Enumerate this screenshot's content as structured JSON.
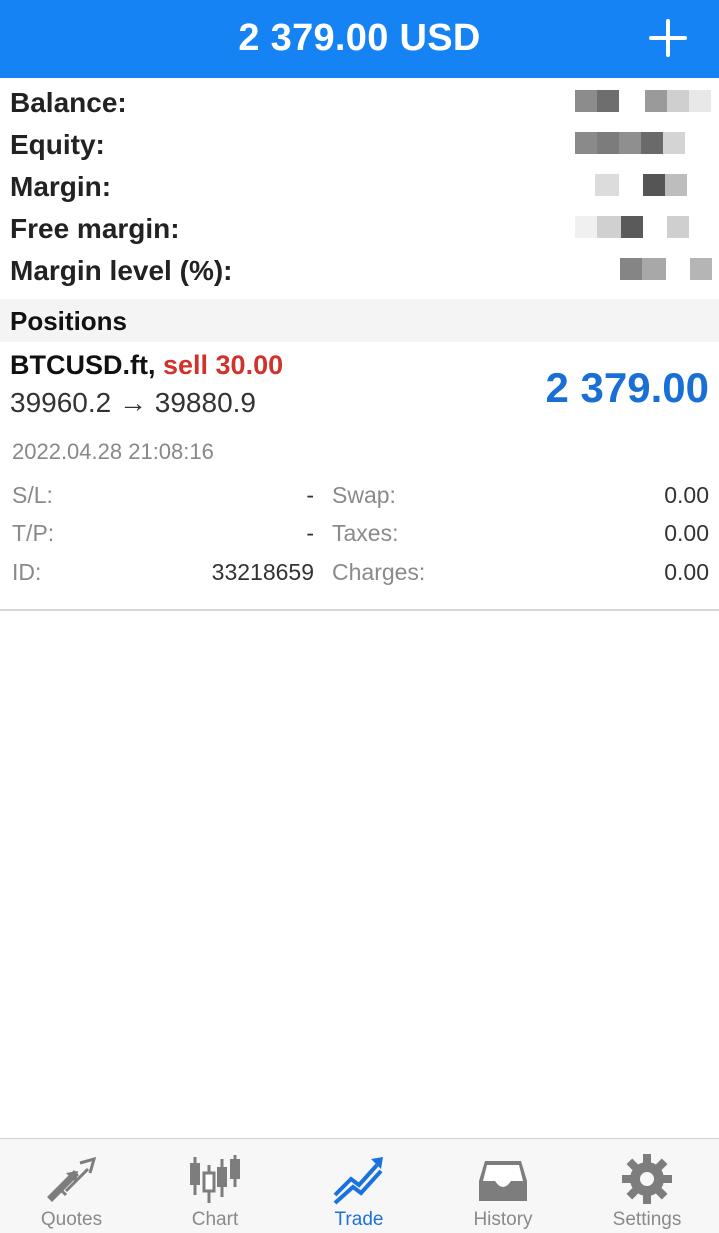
{
  "header": {
    "balance_title": "2 379.00 USD",
    "add_icon": "plus-icon"
  },
  "summary": {
    "items": [
      {
        "label": "Balance:"
      },
      {
        "label": "Equity:"
      },
      {
        "label": "Margin:"
      },
      {
        "label": "Free margin:"
      },
      {
        "label": "Margin level (%):"
      }
    ]
  },
  "positions": {
    "section_title": "Positions",
    "item": {
      "symbol": "BTCUSD.ft,",
      "side": "sell 30.00",
      "price_open": "39960.2",
      "arrow": "→",
      "price_current": "39880.9",
      "profit": "2 379.00",
      "time": "2022.04.28 21:08:16",
      "sl_label": "S/L:",
      "sl_value": "-",
      "tp_label": "T/P:",
      "tp_value": "-",
      "id_label": "ID:",
      "id_value": "33218659",
      "swap_label": "Swap:",
      "swap_value": "0.00",
      "taxes_label": "Taxes:",
      "taxes_value": "0.00",
      "charges_label": "Charges:",
      "charges_value": "0.00"
    }
  },
  "tabs": [
    {
      "label": "Quotes",
      "icon": "quotes-arrows-icon",
      "active": false
    },
    {
      "label": "Chart",
      "icon": "candlestick-chart-icon",
      "active": false
    },
    {
      "label": "Trade",
      "icon": "trade-trend-icon",
      "active": true
    },
    {
      "label": "History",
      "icon": "inbox-tray-icon",
      "active": false
    },
    {
      "label": "Settings",
      "icon": "gear-icon",
      "active": false
    }
  ],
  "colors": {
    "header_bg": "#1683f5",
    "sell": "#d0332b",
    "profit": "#1a6fd4",
    "tab_active": "#1a73dc",
    "tab_inactive": "#8a8a8a"
  }
}
